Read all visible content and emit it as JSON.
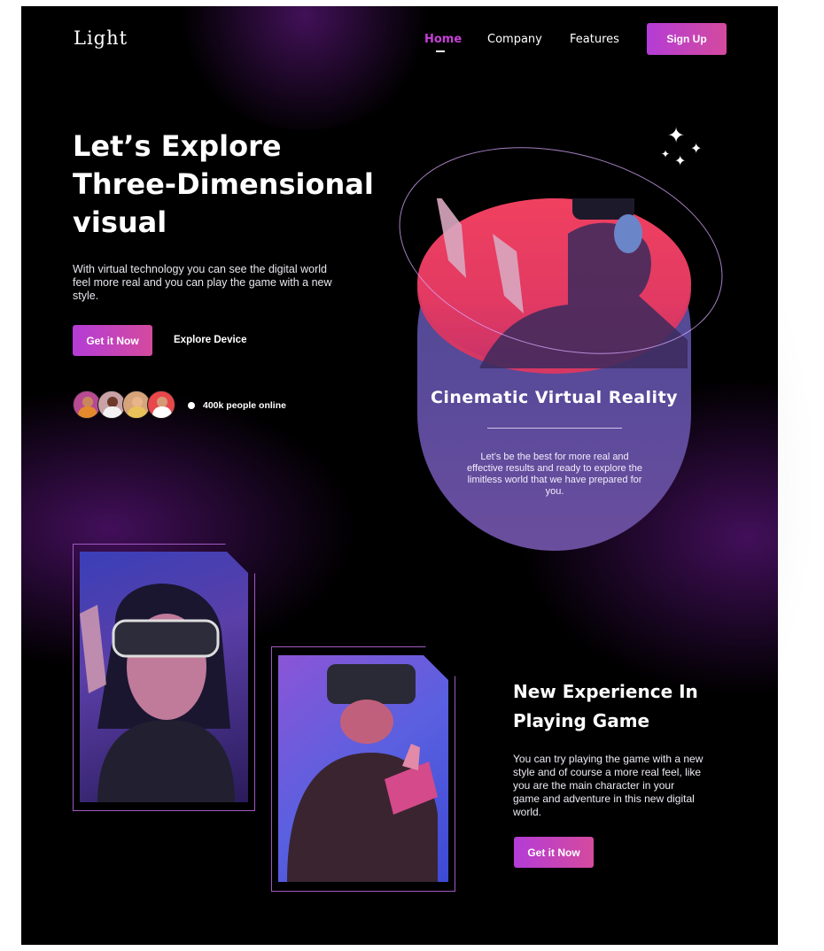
{
  "brand": {
    "logo": "Light"
  },
  "nav": {
    "home": "Home",
    "company": "Company",
    "features": "Features",
    "signup": "Sign Up"
  },
  "hero": {
    "title_line1": "Let’s Explore",
    "title_line2": "Three-Dimensional",
    "title_line3": "visual",
    "description": "With virtual technology you can see the digital world feel more real and you can play the game with a new style.",
    "cta_primary": "Get it Now",
    "cta_secondary": "Explore Device",
    "online_text": "400k people online"
  },
  "feature_card": {
    "title": "Cinematic Virtual Reality",
    "description": "Let’s be the best for more real and effective results and ready to explore the limitless world that we have prepared for you."
  },
  "experience": {
    "title_line1": "New Experience In",
    "title_line2": "Playing Game",
    "description": "You can try playing the game with a new style and of course a more real feel, like you are the main character in your game and adventure in this new digital world.",
    "cta": "Get it Now"
  },
  "colors": {
    "accent": "#c640d8",
    "button_start": "#b43cd6",
    "button_end": "#d44a9e",
    "background": "#000000",
    "card_top": "#f04060",
    "card_body": "#5a4a9a"
  },
  "icons": [
    "sparkle-icon",
    "online-dot-icon"
  ]
}
